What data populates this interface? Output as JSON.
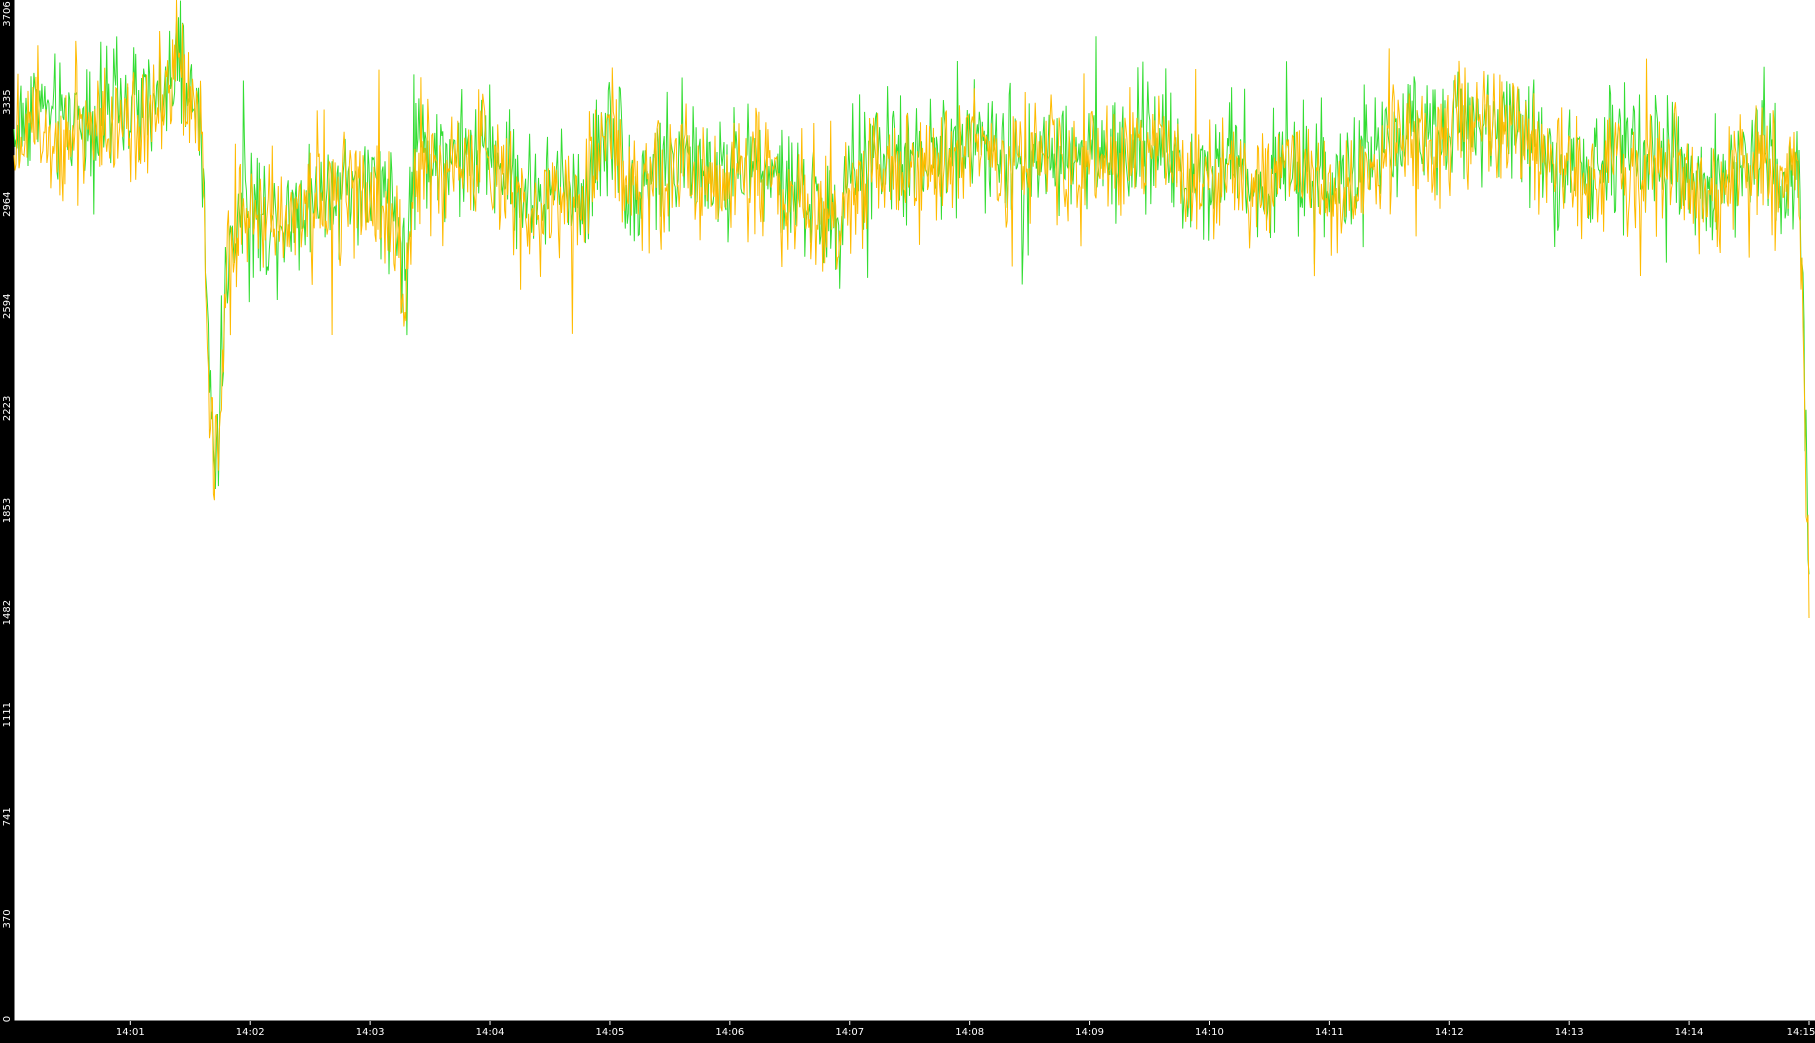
{
  "chart_data": {
    "type": "line",
    "title": "",
    "xlabel": "",
    "ylabel": "",
    "ylim": [
      0,
      3706
    ],
    "y_ticks": [
      "0",
      "370",
      "741",
      "1111",
      "1482",
      "1853",
      "2223",
      "2594",
      "2964",
      "3335",
      "3706"
    ],
    "x_ticks": [
      "14:01",
      "14:02",
      "14:03",
      "14:04",
      "14:05",
      "14:06",
      "14:07",
      "14:08",
      "14:09",
      "14:10",
      "14:11",
      "14:12",
      "14:13",
      "14:14",
      "14:15"
    ],
    "x_tick_minutes": [
      1,
      2,
      3,
      4,
      5,
      6,
      7,
      8,
      9,
      10,
      11,
      12,
      13,
      14,
      15
    ],
    "x_range_minutes": [
      0.03,
      15.0
    ],
    "grid": false,
    "legend": "none",
    "background": "#ffffff",
    "axis_color": "#000000",
    "series": [
      {
        "color": "#33dd33",
        "x": [
          0.03,
          0.2,
          0.4,
          0.6,
          0.8,
          1.0,
          1.2,
          1.4,
          1.5,
          1.6,
          1.65,
          1.7,
          1.75,
          1.8,
          1.9,
          2.0,
          2.2,
          2.4,
          2.6,
          2.8,
          3.0,
          3.2,
          3.3,
          3.35,
          3.4,
          3.6,
          3.8,
          4.0,
          4.2,
          4.4,
          4.6,
          4.8,
          5.0,
          5.2,
          5.4,
          5.6,
          5.8,
          6.0,
          6.2,
          6.4,
          6.6,
          6.8,
          6.9,
          7.0,
          7.2,
          7.4,
          7.6,
          7.8,
          8.0,
          8.2,
          8.4,
          8.6,
          8.8,
          9.0,
          9.2,
          9.4,
          9.6,
          9.8,
          10.0,
          10.2,
          10.4,
          10.6,
          10.8,
          11.0,
          11.2,
          11.4,
          11.6,
          11.8,
          12.0,
          12.2,
          12.4,
          12.6,
          12.8,
          13.0,
          13.2,
          13.4,
          13.6,
          13.8,
          14.0,
          14.2,
          14.4,
          14.6,
          14.8,
          14.9,
          14.95,
          15.0
        ],
        "y": [
          3200,
          3350,
          3250,
          3300,
          3280,
          3330,
          3300,
          3450,
          3380,
          3200,
          2400,
          2050,
          2250,
          2700,
          2950,
          2950,
          2900,
          2980,
          3000,
          3060,
          3010,
          2960,
          2700,
          3000,
          3180,
          3150,
          3120,
          3170,
          3040,
          2980,
          3030,
          3000,
          3280,
          3000,
          3100,
          3150,
          3060,
          3100,
          3120,
          3040,
          3000,
          2950,
          2850,
          3050,
          3150,
          3120,
          3100,
          3150,
          3200,
          3150,
          3120,
          3160,
          3140,
          3150,
          3120,
          3180,
          3200,
          3060,
          3100,
          3150,
          3050,
          3070,
          3100,
          3050,
          3050,
          3180,
          3180,
          3200,
          3280,
          3270,
          3300,
          3250,
          3160,
          3100,
          3100,
          3150,
          3100,
          3120,
          3080,
          3040,
          3120,
          3180,
          3050,
          3200,
          2700,
          1650
        ]
      },
      {
        "color": "#ffbb00",
        "x": [
          0.03,
          0.2,
          0.4,
          0.6,
          0.8,
          1.0,
          1.2,
          1.4,
          1.5,
          1.6,
          1.65,
          1.7,
          1.75,
          1.8,
          1.9,
          2.0,
          2.2,
          2.4,
          2.6,
          2.8,
          3.0,
          3.2,
          3.3,
          3.35,
          3.4,
          3.6,
          3.8,
          4.0,
          4.2,
          4.4,
          4.6,
          4.8,
          5.0,
          5.2,
          5.4,
          5.6,
          5.8,
          6.0,
          6.2,
          6.4,
          6.6,
          6.8,
          6.9,
          7.0,
          7.2,
          7.4,
          7.6,
          7.8,
          8.0,
          8.2,
          8.4,
          8.6,
          8.8,
          9.0,
          9.2,
          9.4,
          9.6,
          9.8,
          10.0,
          10.2,
          10.4,
          10.6,
          10.8,
          11.0,
          11.2,
          11.4,
          11.6,
          11.8,
          12.0,
          12.2,
          12.4,
          12.6,
          12.8,
          13.0,
          13.2,
          13.4,
          13.6,
          13.8,
          14.0,
          14.2,
          14.4,
          14.6,
          14.8,
          14.9,
          14.95,
          15.0
        ],
        "y": [
          3150,
          3300,
          3220,
          3260,
          3250,
          3300,
          3280,
          3420,
          3350,
          3150,
          2300,
          2000,
          2200,
          2650,
          2900,
          2920,
          2880,
          2950,
          2980,
          3030,
          2990,
          2940,
          2600,
          2980,
          3150,
          3120,
          3100,
          3140,
          3010,
          2960,
          3000,
          2980,
          3250,
          2980,
          3070,
          3120,
          3030,
          3070,
          3100,
          3010,
          2980,
          2930,
          2820,
          3020,
          3120,
          3100,
          3080,
          3120,
          3170,
          3120,
          3100,
          3130,
          3110,
          3120,
          3100,
          3150,
          3170,
          3030,
          3070,
          3120,
          3020,
          3040,
          3070,
          3020,
          3020,
          3150,
          3150,
          3170,
          3250,
          3240,
          3270,
          3220,
          3130,
          3070,
          3070,
          3120,
          3070,
          3090,
          3050,
          3010,
          3090,
          3150,
          3020,
          3170,
          2600,
          1600
        ]
      }
    ]
  }
}
